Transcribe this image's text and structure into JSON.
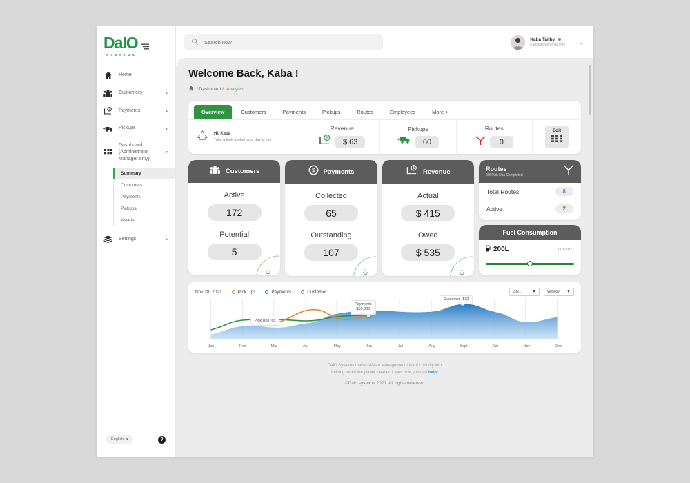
{
  "brand": {
    "name": "DalO",
    "tagline": "SYSTEMS"
  },
  "search": {
    "placeholder": "Search now"
  },
  "profile": {
    "name": "Kaba Taliby",
    "email": "Kabataliby@gmail.com"
  },
  "sidebar": {
    "items": [
      {
        "label": "Home",
        "icon": "home-icon",
        "caret": ""
      },
      {
        "label": "Customers",
        "icon": "customers-icon",
        "caret": "▲"
      },
      {
        "label": "Payments",
        "icon": "payments-icon",
        "caret": "▲"
      },
      {
        "label": "Pickups",
        "icon": "truck-icon",
        "caret": "▲"
      },
      {
        "label": "Dashboard (Administrator Manager only)",
        "icon": "grid-icon",
        "caret": "▼"
      },
      {
        "label": "Settings",
        "icon": "layers-icon",
        "caret": "▲"
      }
    ],
    "subitems": [
      "Summary",
      "Customers",
      "Payments",
      "Pickups",
      "Assets"
    ],
    "active_subitem": "Summary",
    "language": "English",
    "help": "?"
  },
  "page": {
    "title": "Welcome Back, Kaba !",
    "breadcrumb": {
      "home_icon": "home-icon",
      "path": "/ Dashboard /",
      "current": "Analytics"
    }
  },
  "tabs": [
    {
      "label": "Overview",
      "active": true
    },
    {
      "label": "Customers",
      "active": false
    },
    {
      "label": "Payments",
      "active": false
    },
    {
      "label": "Pickups",
      "active": false
    },
    {
      "label": "Routes",
      "active": false
    },
    {
      "label": "Employees",
      "active": false
    },
    {
      "label": "More +",
      "active": false
    }
  ],
  "summary": {
    "greeting": "Hi, Kaba",
    "subtitle": "Take a look a what your day is like",
    "stats": [
      {
        "label": "Revenue",
        "value": "$ 63",
        "icon": "revenue-icon"
      },
      {
        "label": "Pickups",
        "value": "60",
        "icon": "truck-icon"
      },
      {
        "label": "Routes",
        "value": "0",
        "icon": "routes-icon"
      }
    ],
    "edit_label": "Edit"
  },
  "kpis": [
    {
      "title": "Customers",
      "icon": "customers-icon",
      "rows": [
        {
          "label": "Active",
          "value": "172"
        },
        {
          "label": "Potential",
          "value": "5"
        }
      ]
    },
    {
      "title": "Payments",
      "icon": "dollar-circle-icon",
      "rows": [
        {
          "label": "Collected",
          "value": "65"
        },
        {
          "label": "Outstanding",
          "value": "107"
        }
      ]
    },
    {
      "title": "Revenue",
      "icon": "revenue-icon",
      "rows": [
        {
          "label": "Actual",
          "value": "$ 415"
        },
        {
          "label": "Owed",
          "value": "$ 535"
        }
      ]
    }
  ],
  "routes_card": {
    "title": "Routes",
    "subtitle": "2/8 Pick Ups Completed",
    "icon": "routes-icon",
    "rows": [
      {
        "label": "Total Routes",
        "value": "8",
        "color": "#3f8ed0"
      },
      {
        "label": "Active",
        "value": "2",
        "color": "#2e9443"
      }
    ]
  },
  "fuel_card": {
    "title": "Fuel Consumption",
    "amount": "200L",
    "date": "11/1/2021",
    "icon": "fuel-icon",
    "slider_percent": 50
  },
  "chart_data": {
    "type": "area",
    "title": "",
    "date_label": "Nov 28, 2021",
    "categories": [
      "Jan",
      "Feb",
      "Mar",
      "Apr",
      "May",
      "Jun",
      "Jul",
      "Aug",
      "Sept",
      "Oct",
      "Nov",
      "Dec"
    ],
    "xlabel": "",
    "ylabel": "",
    "grid": true,
    "legend_position": "top",
    "legend": [
      {
        "name": "Pick Ups",
        "color": "#e8822a"
      },
      {
        "name": "Payments",
        "color": "#2e9443"
      },
      {
        "name": "Customer",
        "color": "#3f8ed0"
      }
    ],
    "series": [
      {
        "name": "Customer",
        "color": "#3f8ed0",
        "type": "area",
        "values": [
          12,
          24,
          27,
          22,
          32,
          54,
          58,
          55,
          72,
          60,
          34,
          42
        ]
      },
      {
        "name": "Payments",
        "color": "#2e9443",
        "type": "line",
        "values": [
          22,
          38,
          42,
          40,
          44,
          52,
          null,
          null,
          null,
          null,
          null,
          null
        ]
      },
      {
        "name": "Pick Ups",
        "color": "#e8822a",
        "type": "line",
        "values": [
          null,
          null,
          34,
          58,
          40,
          56,
          null,
          null,
          null,
          null,
          null,
          null
        ]
      }
    ],
    "annotations": [
      {
        "series": "Pick Ups",
        "label": "Pick Ups",
        "value": "65",
        "x": "Mar"
      },
      {
        "series": "Payments",
        "label": "Payments",
        "value": "$10,000",
        "x": "May"
      },
      {
        "series": "Customer",
        "label": "Customer",
        "value": "172",
        "x": "Sept"
      }
    ],
    "controls": [
      {
        "name": "year-select",
        "value": "2021"
      },
      {
        "name": "period-select",
        "value": "Weekly"
      }
    ]
  },
  "footer": {
    "line1": "DalO Systems makes Waste Management their #1 priotity into",
    "line2": "helping make the planet cleaner. Learn how you can",
    "link": "help!",
    "copyright": "©Dalo systems 2021. All rights reserved"
  }
}
